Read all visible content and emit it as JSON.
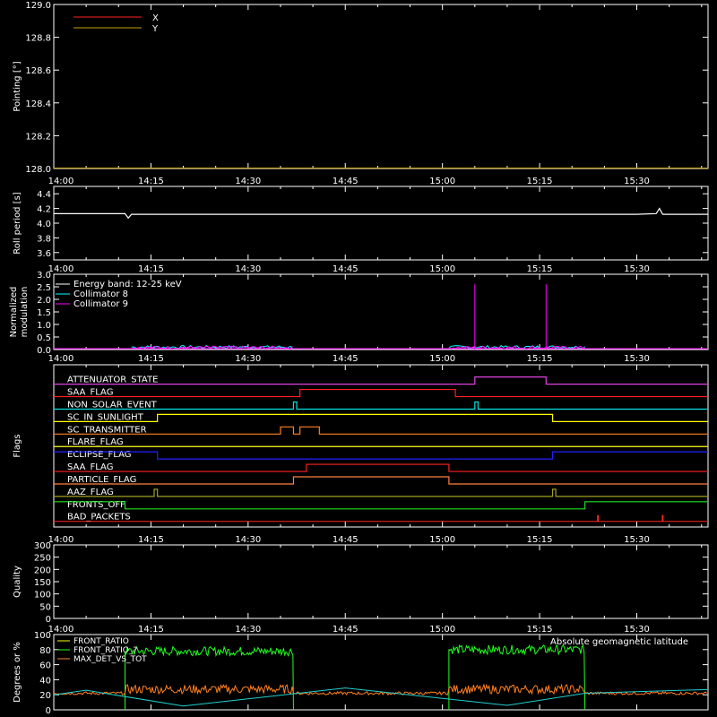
{
  "time_ticks": [
    "14:00",
    "14:15",
    "14:30",
    "14:45",
    "15:00",
    "15:15",
    "15:30"
  ],
  "chart_data": [
    {
      "type": "line",
      "ylabel": "Pointing [°]",
      "ylim": [
        128.0,
        129.0
      ],
      "y_ticks": [
        "128.0",
        "128.2",
        "128.4",
        "128.6",
        "128.8",
        "129.0"
      ],
      "legend": [
        {
          "name": "X",
          "color": "#ff2020"
        },
        {
          "name": "Y",
          "color": "#c8a000"
        }
      ],
      "series": [
        {
          "name": "X",
          "color": "#ff2020",
          "x": [
            "14:00",
            "15:41"
          ],
          "values": [
            128.0,
            128.0
          ]
        },
        {
          "name": "Y",
          "color": "#c8a000",
          "x": [
            "14:00",
            "15:41"
          ],
          "values": [
            128.0,
            128.0
          ]
        }
      ]
    },
    {
      "type": "line",
      "ylabel": "Roll period [s]",
      "ylim": [
        3.5,
        4.5
      ],
      "y_ticks": [
        "3.6",
        "3.8",
        "4.0",
        "4.2",
        "4.4"
      ],
      "series": [
        {
          "color": "#ffffff",
          "x": [
            "14:00",
            "14:11",
            "14:11.5",
            "14:12",
            "14:30",
            "15:30",
            "15:33",
            "15:33.5",
            "15:34",
            "15:41"
          ],
          "values": [
            4.13,
            4.13,
            4.07,
            4.12,
            4.12,
            4.12,
            4.13,
            4.2,
            4.12,
            4.12
          ]
        }
      ]
    },
    {
      "type": "line",
      "ylabel": "Normalized modulation",
      "ylim": [
        0.0,
        3.0
      ],
      "y_ticks": [
        "0.0",
        "0.5",
        "1.0",
        "1.5",
        "2.0",
        "2.5",
        "3.0"
      ],
      "legend": [
        {
          "name": "Energy band: 12-25 keV",
          "color": "#ffffff"
        },
        {
          "name": "Collimator 8",
          "color": "#00ffff"
        },
        {
          "name": "Collimator 9",
          "color": "#ff00ff"
        }
      ],
      "series": [
        {
          "name": "Collimator 8",
          "color": "#00ffff",
          "segments": [
            {
              "x": [
                "14:12",
                "14:37"
              ],
              "values": [
                0.1,
                0.1
              ]
            },
            {
              "x": [
                "15:01",
                "15:22"
              ],
              "values": [
                0.1,
                0.1
              ]
            }
          ]
        },
        {
          "name": "Collimator 9",
          "color": "#ff00ff",
          "segments": [
            {
              "x": [
                "14:12",
                "14:37"
              ],
              "values": [
                0.08,
                0.08
              ]
            },
            {
              "x": [
                "15:01",
                "15:22"
              ],
              "values": [
                0.08,
                0.08
              ]
            }
          ],
          "spikes": [
            {
              "x": "15:05",
              "value": 2.6
            },
            {
              "x": "15:16",
              "value": 2.6
            }
          ]
        }
      ]
    },
    {
      "type": "line",
      "ylabel": "Flags",
      "flags": [
        {
          "name": "ATTENUATOR_STATE",
          "color": "#e040e0",
          "on": [
            [
              "15:05",
              "15:16"
            ]
          ]
        },
        {
          "name": "SAA_FLAG",
          "color": "#ff2020",
          "on": [
            [
              "14:38",
              "15:02"
            ]
          ]
        },
        {
          "name": "NON_SOLAR_EVENT",
          "color": "#00e0e0",
          "on": [
            [
              "14:37",
              "14:37.5"
            ],
            [
              "15:05",
              "15:05.5"
            ]
          ]
        },
        {
          "name": "SC_IN_SUNLIGHT",
          "color": "#ffff00",
          "on": [
            [
              "14:16",
              "15:17"
            ]
          ]
        },
        {
          "name": "SC_TRANSMITTER",
          "color": "#ff8020",
          "on": [
            [
              "14:35",
              "14:37"
            ],
            [
              "14:38",
              "14:41"
            ]
          ]
        },
        {
          "name": "FLARE_FLAG",
          "color": "#ffff20",
          "on": []
        },
        {
          "name": "ECLIPSE_FLAG",
          "color": "#2020ff",
          "on": [
            [
              "14:00",
              "14:16"
            ],
            [
              "15:17",
              "15:41"
            ]
          ]
        },
        {
          "name": "SAA_FLAG",
          "color": "#ff2020",
          "on": [
            [
              "14:39",
              "15:01"
            ]
          ]
        },
        {
          "name": "PARTICLE_FLAG",
          "color": "#ff8040",
          "on": [
            [
              "14:37",
              "15:01"
            ]
          ]
        },
        {
          "name": "AAZ_FLAG",
          "color": "#a0a020",
          "on": [
            [
              "14:15.5",
              "14:16"
            ],
            [
              "15:17",
              "15:17.5"
            ]
          ]
        },
        {
          "name": "FRONTS_OFF",
          "color": "#20e020",
          "on": [
            [
              "14:00",
              "14:11"
            ],
            [
              "15:22",
              "15:41"
            ]
          ]
        },
        {
          "name": "BAD_PACKETS",
          "color": "#ff2020",
          "ticks": [
            "15:24",
            "15:34"
          ]
        }
      ]
    },
    {
      "type": "line",
      "ylabel": "Quality",
      "ylim": [
        0,
        300
      ],
      "y_ticks": [
        "0",
        "50",
        "100",
        "150",
        "200",
        "250",
        "300"
      ],
      "series": []
    },
    {
      "type": "line",
      "ylabel": "Degrees or %",
      "ylim": [
        0,
        100
      ],
      "y_ticks": [
        "0",
        "20",
        "40",
        "60",
        "80",
        "100"
      ],
      "legend": [
        {
          "name": "FRONT_RATIO",
          "color": "#ffff00"
        },
        {
          "name": "FRONT_RATIO_?",
          "color": "#20ff20"
        },
        {
          "name": "MAX_DET_VS_TOT",
          "color": "#ff8020"
        }
      ],
      "annotation": "Absolute geomagnetic latitude",
      "series": [
        {
          "name": "FRONT_RATIO_?",
          "color": "#20ff20",
          "segments": [
            {
              "x": [
                "14:11",
                "14:37"
              ],
              "level": 78
            },
            {
              "x": [
                "15:01",
                "15:22"
              ],
              "level": 80
            }
          ]
        },
        {
          "name": "MAX_DET_VS_TOT",
          "color": "#ff8020",
          "level": 25
        },
        {
          "name": "Absolute geomagnetic latitude",
          "color": "#20d0d0",
          "x": [
            "14:00",
            "14:05",
            "14:20",
            "14:45",
            "15:10",
            "15:22",
            "15:41"
          ],
          "values": [
            20,
            26,
            5,
            29,
            6,
            22,
            27
          ]
        }
      ]
    }
  ]
}
